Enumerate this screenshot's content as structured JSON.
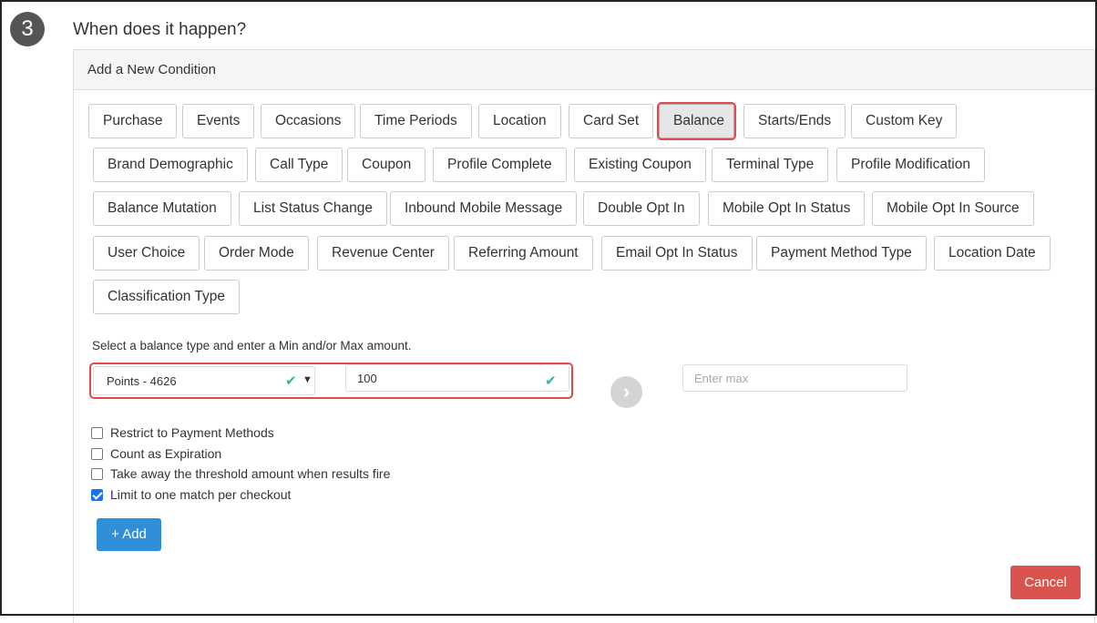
{
  "step": {
    "number": "3",
    "title": "When does it happen?"
  },
  "panel": {
    "heading": "Add a New Condition"
  },
  "conditions": {
    "row1": [
      "Purchase",
      "Events",
      "Occasions",
      "Time Periods",
      "Location",
      "Card Set",
      "Balance",
      "Starts/Ends",
      "Custom Key"
    ],
    "row2": [
      "Brand Demographic",
      "Call Type",
      "Coupon",
      "Profile Complete",
      "Existing Coupon",
      "Terminal Type",
      "Profile Modification"
    ],
    "row3": [
      "Balance Mutation",
      "List Status Change",
      "Inbound Mobile Message",
      "Double Opt In",
      "Mobile Opt In Status",
      "Mobile Opt In Source"
    ],
    "row4": [
      "User Choice",
      "Order Mode",
      "Revenue Center",
      "Referring Amount",
      "Email Opt In Status",
      "Payment Method Type",
      "Location Date"
    ],
    "row5": [
      "Classification Type"
    ],
    "selected": "Balance"
  },
  "balance_form": {
    "instruction": "Select a balance type and enter a Min and/or Max amount.",
    "balance_type": "Points - 4626",
    "min_value": "100",
    "max_placeholder": "Enter max"
  },
  "options": [
    {
      "label": "Restrict to Payment Methods",
      "checked": false
    },
    {
      "label": "Count as Expiration",
      "checked": false
    },
    {
      "label": "Take away the threshold amount when results fire",
      "checked": false
    },
    {
      "label": "Limit to one match per checkout",
      "checked": true
    }
  ],
  "actions": {
    "add_label": "+ Add",
    "cancel_label": "Cancel"
  },
  "colors": {
    "highlight": "#e14a4a",
    "primary": "#2f8fd8",
    "danger": "#d9534f",
    "success_check": "#2fb3a3"
  }
}
